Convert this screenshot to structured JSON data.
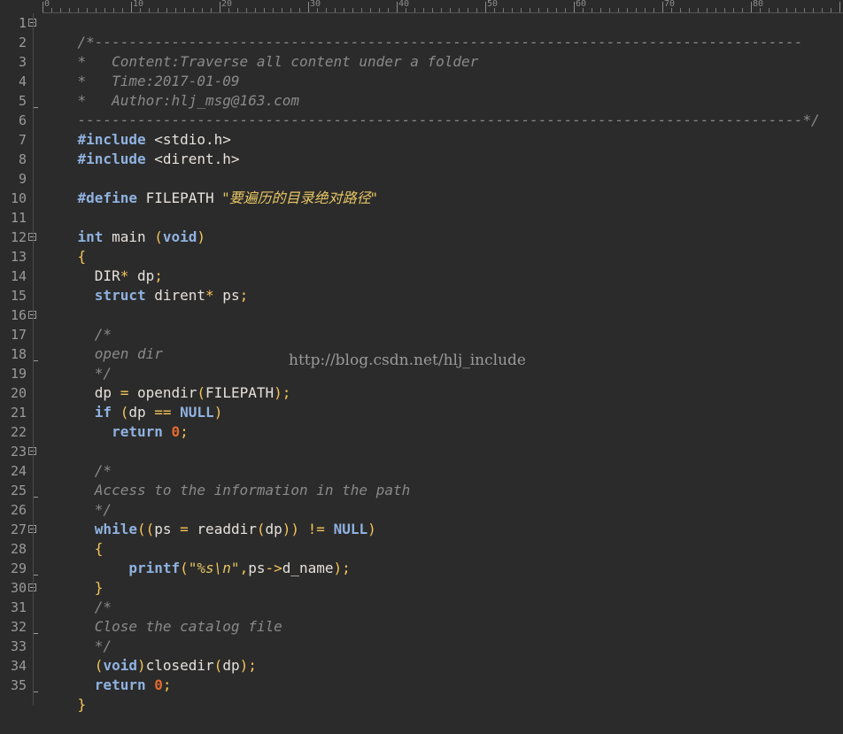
{
  "editor": {
    "ruler_labels": [
      "0",
      "10",
      "20",
      "30",
      "40",
      "50",
      "60",
      "70",
      "80"
    ],
    "line_numbers": [
      "1",
      "2",
      "3",
      "4",
      "5",
      "6",
      "7",
      "8",
      "9",
      "10",
      "11",
      "12",
      "13",
      "14",
      "15",
      "16",
      "17",
      "18",
      "19",
      "20",
      "21",
      "22",
      "23",
      "24",
      "25",
      "26",
      "27",
      "28",
      "29",
      "30",
      "31",
      "32",
      "33",
      "34",
      "35"
    ],
    "fold_markers": [
      "1",
      "12",
      "16",
      "23",
      "27",
      "30"
    ],
    "watermark": "http://blog.csdn.net/hlj_include"
  },
  "code": {
    "l1": "/*-----------------------------------------------------------------------------------",
    "l2": "*   Content:Traverse all content under a folder",
    "l3": "*   Time:2017-01-09",
    "l4": "*   Author:hlj_msg@163.com",
    "l5": "-------------------------------------------------------------------------------------*/",
    "include": "#include",
    "l6_hdr": " <stdio.h>",
    "l7_hdr": " <dirent.h>",
    "define": "#define",
    "l9_name": " FILEPATH ",
    "l9_str": "\"要遍历的目录绝对路径\"",
    "int": "int",
    "main": " main ",
    "lparen": "(",
    "rparen": ")",
    "void": "void",
    "lbrace": "{",
    "rbrace": "}",
    "indent1": "  ",
    "indent2": "    ",
    "indent3": "      ",
    "dir": "DIR",
    "star": "*",
    "dp_decl": " dp",
    "semi": ";",
    "struct": "struct",
    "dirent": " dirent",
    "ps_decl": " ps",
    "c_open": "/*",
    "c_close": "*/",
    "c17": "open dir",
    "dp_assign": "dp ",
    "eq": "=",
    "opendir": " opendir",
    "filepath": "FILEPATH",
    "if": "if",
    "sp": " ",
    "dp": "dp",
    "eqeq": "==",
    "null": "NULL",
    "return": "return",
    "zero": "0",
    "c24": "Access to the information in the path",
    "while": "while",
    "lparen2": "((",
    "ps": "ps",
    "readdir": "readdir",
    "rparen2": "))",
    "neq": "!=",
    "printf": "printf",
    "fmt": "\"%s\\n\"",
    "comma": ",",
    "arrow": "->",
    "d_name": "d_name",
    "c31": "Close the catalog file",
    "closedir": "closedir"
  }
}
